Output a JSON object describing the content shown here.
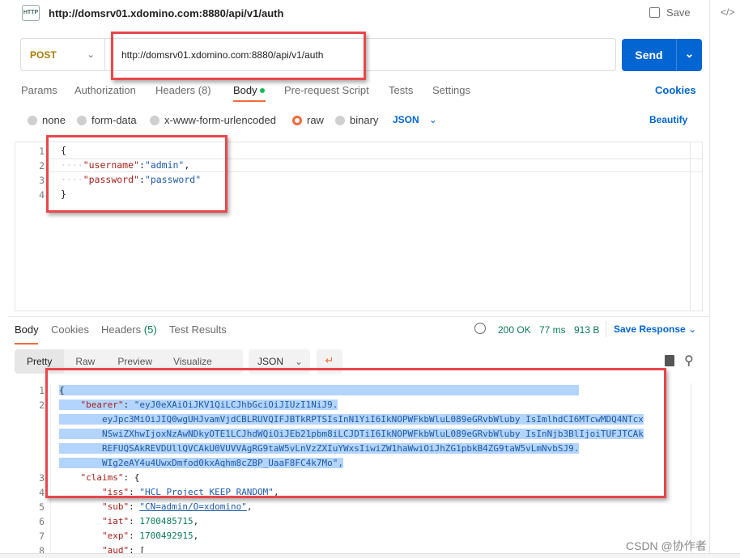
{
  "header": {
    "icon": "HTTP",
    "title": "http://domsrv01.xdomino.com:8880/api/v1/auth",
    "save_label": "Save",
    "code_icon": "</>"
  },
  "request": {
    "method": "POST",
    "url": "http://domsrv01.xdomino.com:8880/api/v1/auth",
    "send_label": "Send"
  },
  "tabs": [
    "Params",
    "Authorization",
    "Headers (8)",
    "Body",
    "Pre-request Script",
    "Tests",
    "Settings"
  ],
  "active_tab": "Body",
  "cookies_label": "Cookies",
  "body_types": [
    "none",
    "form-data",
    "x-www-form-urlencoded",
    "raw",
    "binary"
  ],
  "selected_body_type": "raw",
  "format": "JSON",
  "beautify_label": "Beautify",
  "request_body": {
    "line_numbers": [
      "1",
      "2",
      "3",
      "4"
    ],
    "open": "{",
    "l2_key": "\"username\"",
    "l2_val": "\"admin\"",
    "l3_key": "\"password\"",
    "l3_val": "\"password\"",
    "close": "}"
  },
  "response": {
    "tabs": [
      "Body",
      "Cookies",
      "Headers",
      "Test Results"
    ],
    "headers_count": "(5)",
    "status": "200 OK",
    "time": "77 ms",
    "size": "913 B",
    "save_response": "Save Response",
    "view_tabs": [
      "Pretty",
      "Raw",
      "Preview",
      "Visualize"
    ],
    "format": "JSON",
    "line_numbers": [
      "1",
      "2",
      "3",
      "4",
      "5",
      "6",
      "7",
      "8"
    ],
    "lines": {
      "open": "{",
      "bearer_key": "\"bearer\"",
      "bearer_1": "\"eyJ0eXAiOiJKV1QiLCJhbGciOiJIUzI1NiJ9.",
      "bearer_2": "eyJpc3MiOiJIQ0wgUHJvamVjdCBLRUVQIFJBTkRPTSIsInN1YiI6IkNOPWFkbWluL089eGRvbWluby IsImlhdCI6MTcwMDQ4NTcx",
      "bearer_3": "NSwiZXhwIjoxNzAwNDkyOTE1LCJhdWQiOiJEb21pbm8iLCJDTiI6IkNOPWFkbWluL089eGRvbWluby IsInNjb3BlIjoiTUFJTCAk",
      "bearer_4": "REFUQSAkREVDUllQVCAkU0VUVVAgRG9taW5vLnVzZXIuYWxsIiwiZW1haWwiOiJhZG1pbkB4ZG9taW5vLmNvbSJ9.",
      "bearer_5": "WIg2eAY4u4UwxDmfod0kxAqhm8cZBP_UaaF8FC4k7Mo\",",
      "claims_key": "\"claims\"",
      "iss_key": "\"iss\"",
      "iss_val": "\"HCL Project KEEP RANDOM\"",
      "sub_key": "\"sub\"",
      "sub_val": "\"CN=admin/O=xdomino\"",
      "iat_key": "\"iat\"",
      "iat_val": "1700485715",
      "exp_key": "\"exp\"",
      "exp_val": "1700492915",
      "aud_key": "\"aud\"",
      "aud_val": "["
    }
  },
  "watermark": "CSDN @协作者"
}
